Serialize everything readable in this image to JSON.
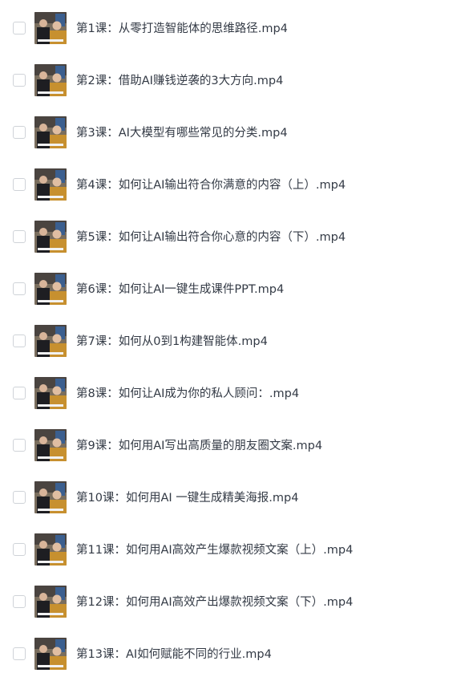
{
  "files": [
    {
      "name": "第1课：从零打造智能体的思维路径.mp4"
    },
    {
      "name": "第2课：借助AI赚钱逆袭的3大方向.mp4"
    },
    {
      "name": "第3课：AI大模型有哪些常见的分类.mp4"
    },
    {
      "name": "第4课：如何让AI输出符合你满意的内容（上）.mp4"
    },
    {
      "name": "第5课：如何让AI输出符合你心意的内容（下）.mp4"
    },
    {
      "name": "第6课：如何让AI一键生成课件PPT.mp4"
    },
    {
      "name": "第7课：如何从0到1构建智能体.mp4"
    },
    {
      "name": "第8课：如何让AI成为你的私人顾问：.mp4"
    },
    {
      "name": "第9课：如何用AI写出高质量的朋友圈文案.mp4"
    },
    {
      "name": "第10课：如何用AI 一键生成精美海报.mp4"
    },
    {
      "name": "第11课：如何用AI高效产生爆款视频文案（上）.mp4"
    },
    {
      "name": "第12课：如何用AI高效产出爆款视频文案（下）.mp4"
    },
    {
      "name": "第13课：AI如何赋能不同的行业.mp4"
    }
  ],
  "thumbnail_icon": "video-thumbnail-icon",
  "colors": {
    "text": "#333a45",
    "checkbox_border": "#cfd3d8",
    "background": "#ffffff"
  }
}
